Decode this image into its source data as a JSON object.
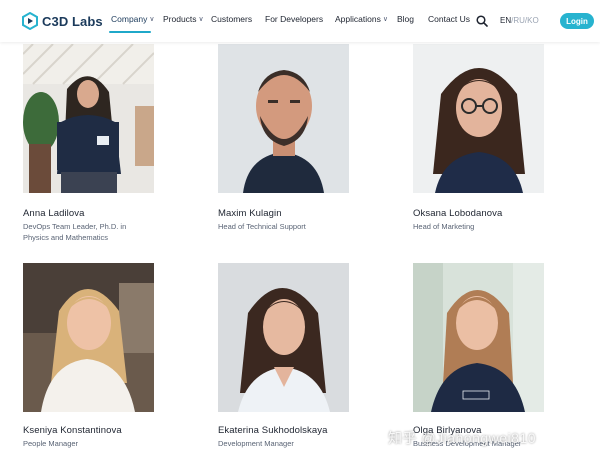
{
  "brand": {
    "name": "C3D Labs",
    "accent": "#27b3cf"
  },
  "nav": {
    "items": [
      {
        "label": "Company",
        "dropdown": true,
        "active": true
      },
      {
        "label": "Products",
        "dropdown": true
      },
      {
        "label": "Customers",
        "dropdown": false
      },
      {
        "label": "For Developers",
        "dropdown": false
      },
      {
        "label": "Applications",
        "dropdown": true
      },
      {
        "label": "Blog",
        "dropdown": false
      },
      {
        "label": "Contact Us",
        "dropdown": false
      }
    ],
    "search_icon": "search-icon",
    "languages": {
      "current": "EN",
      "sep1": "/",
      "lang2": "RU",
      "sep2": "/",
      "lang3": "KO"
    },
    "login_label": "Login"
  },
  "team": [
    {
      "name": "Anna Ladilova",
      "role_line1": "DevOps Team Leader, Ph.D. in",
      "role_line2": "Physics and Mathematics"
    },
    {
      "name": "Maxim Kulagin",
      "role_line1": "Head of Technical Support",
      "role_line2": ""
    },
    {
      "name": "Oksana Lobodanova",
      "role_line1": "Head of Marketing",
      "role_line2": ""
    },
    {
      "name": "Kseniya Konstantinova",
      "role_line1": "People Manager",
      "role_line2": ""
    },
    {
      "name": "Ekaterina Sukhodolskaya",
      "role_line1": "Development Manager",
      "role_line2": ""
    },
    {
      "name": "Olga Birlyanova",
      "role_line1": "Business Development Manager",
      "role_line2": ""
    }
  ],
  "watermark": "知乎 @Jiahongwei810"
}
